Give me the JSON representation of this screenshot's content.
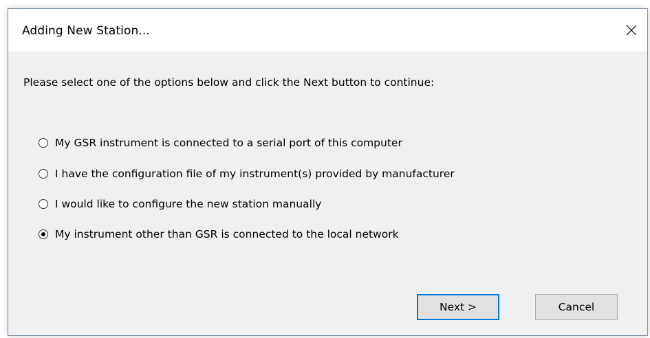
{
  "dialog": {
    "title": "Adding New Station...",
    "close_icon": "close-icon",
    "instruction": "Please select one of the options below and click the Next button to continue:",
    "options": [
      {
        "label": "My GSR instrument is connected to a serial port of this computer",
        "selected": false
      },
      {
        "label": "I have the configuration file of my instrument(s) provided by manufacturer",
        "selected": false
      },
      {
        "label": "I would like to configure the new station manually",
        "selected": false
      },
      {
        "label": "My instrument other than GSR is connected to the local network",
        "selected": true
      }
    ],
    "buttons": {
      "next_label": "Next >",
      "cancel_label": "Cancel"
    }
  },
  "colors": {
    "dialog_bg": "#f0f0f0",
    "titlebar_bg": "#ffffff",
    "default_button_border": "#0078d7",
    "button_bg": "#e1e1e1"
  }
}
